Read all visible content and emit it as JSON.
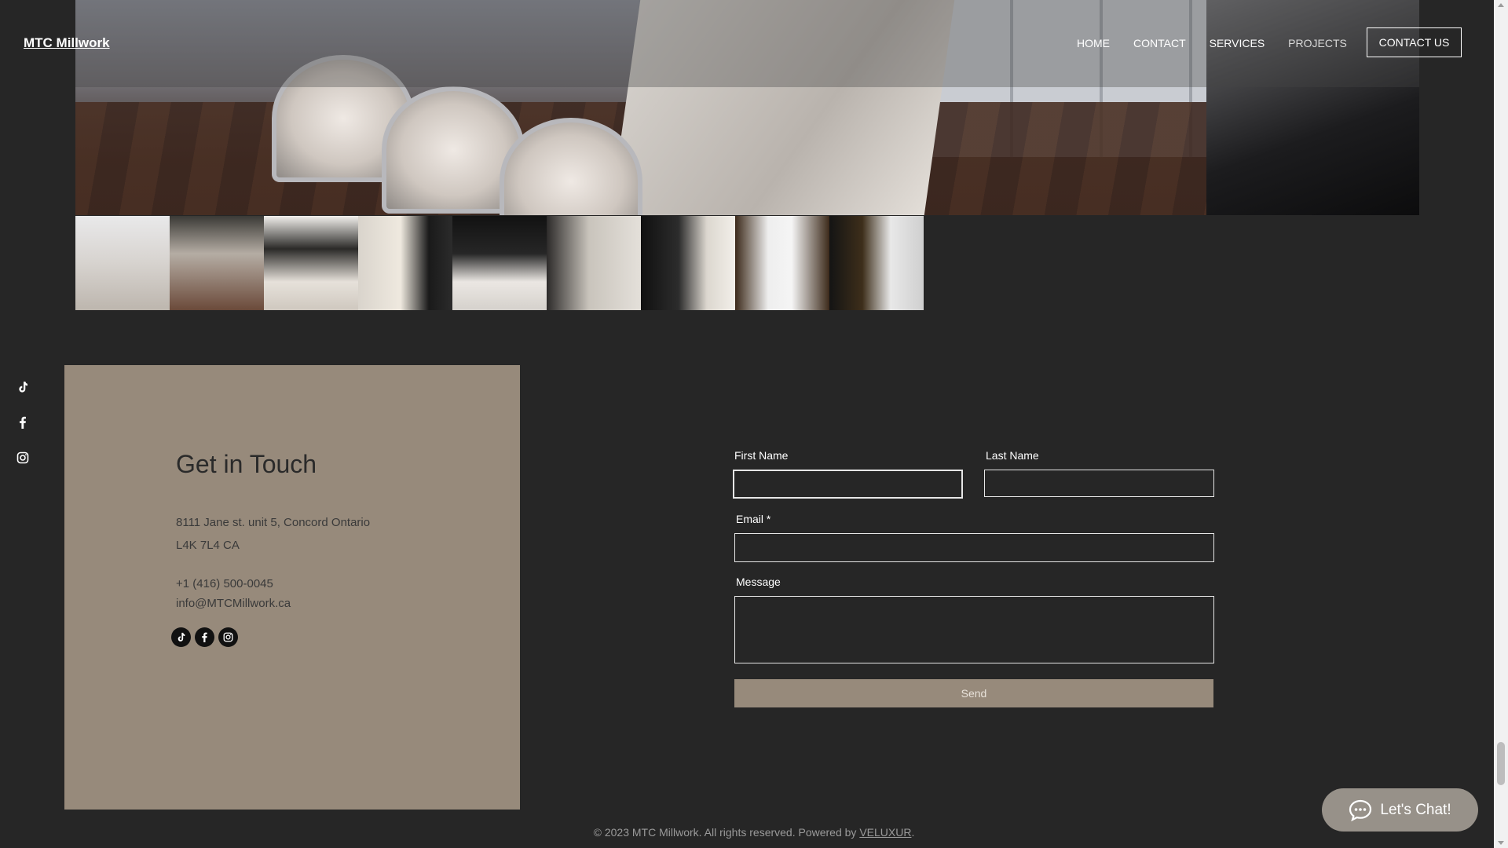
{
  "site": {
    "logo": "MTC Millwork",
    "nav": [
      "HOME",
      "CONTACT",
      "SERVICES",
      "PROJECTS"
    ],
    "current_nav": "PROJECTS",
    "cta": "CONTACT US"
  },
  "gallery": {
    "thumbnails_shown": 9
  },
  "social_icons": [
    "tiktok-icon",
    "facebook-icon",
    "instagram-icon"
  ],
  "contact_panel": {
    "heading": "Get in Touch",
    "address_line1": "8111 Jane st. unit 5, Concord Ontario",
    "address_line2": "L4K 7L4 CA",
    "phone": "+1 (416) 500-0045",
    "email": "info@MTCMillwork.ca"
  },
  "form": {
    "first_name_label": "First Name",
    "first_name_value": "",
    "last_name_label": "Last Name",
    "last_name_value": "",
    "email_label": "Email *",
    "email_value": "",
    "message_label": "Message",
    "message_value": "",
    "send_label": "Send"
  },
  "footer": {
    "text": "© 2023 MTC Millwork. All rights reserved. Powered by ",
    "link": "VELUXUR",
    "end": "."
  },
  "chat": {
    "label": "Let's Chat!"
  },
  "colors": {
    "background": "#262626",
    "panel": "#978a7b",
    "button": "#978a7b",
    "chat": "#979189"
  }
}
